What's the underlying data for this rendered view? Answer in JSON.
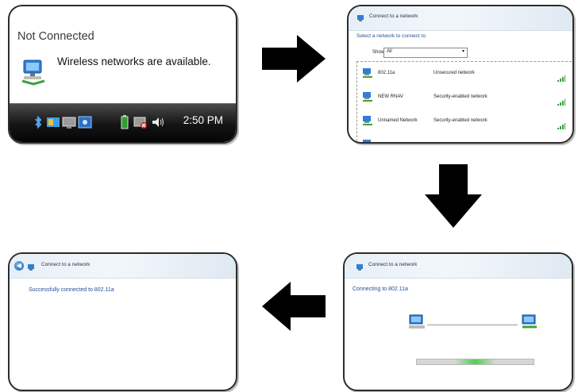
{
  "panel1": {
    "title": "Not Connected",
    "message": "Wireless networks are available.",
    "clock": "2:50 PM"
  },
  "panel2": {
    "window_title": "Connect to a network",
    "heading": "Select a network to connect to",
    "show_label": "Show",
    "show_value": "All",
    "networks": [
      {
        "name": "802.11a",
        "security": "Unsecured network"
      },
      {
        "name": "NEW RNAV",
        "security": "Security-enabled network"
      },
      {
        "name": "Unnamed Network",
        "security": "Security-enabled network"
      }
    ]
  },
  "panel3": {
    "window_title": "Connect to a network",
    "status": "Successfully connected to 802.11a"
  },
  "panel4": {
    "window_title": "Connect to a network",
    "status": "Connecting to 802.11a",
    "progress_glow_fraction": 0.35
  },
  "colors": {
    "link_blue": "#1f4f99",
    "signal_green": "#3aa33a",
    "arrow": "#000000"
  },
  "icons": [
    "network-icon",
    "bluetooth-icon",
    "battery-icon",
    "volume-icon",
    "signal-bars-icon",
    "back-icon",
    "computer-icon"
  ]
}
